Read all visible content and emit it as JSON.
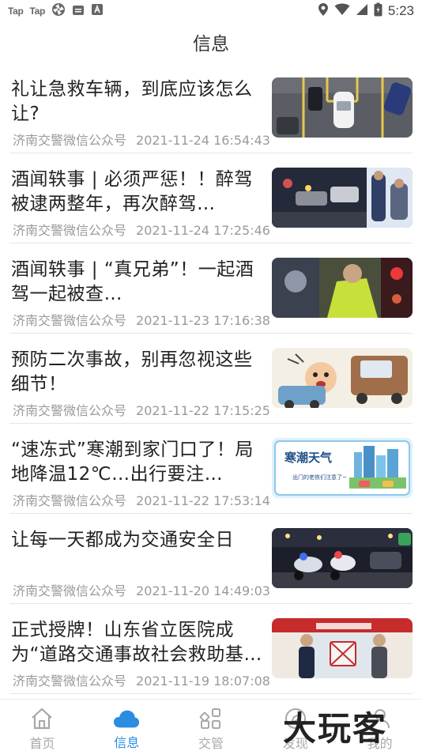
{
  "status_bar": {
    "apps": [
      "Tap",
      "Tap"
    ],
    "time": "5:23"
  },
  "header": {
    "title": "信息"
  },
  "news": [
    {
      "title": "礼让急救车辆，到底应该怎么让?",
      "source": "济南交警微信公众号",
      "datetime": "2021-11-24 16:54:43",
      "image": "parking-lot-cars"
    },
    {
      "title": "酒闻轶事 | 必须严惩！！醉驾被逮两整年，再次醉驾…",
      "source": "济南交警微信公众号",
      "datetime": "2021-11-24 17:25:46",
      "image": "night-checkpoint"
    },
    {
      "title": "酒闻轶事 | “真兄弟”！一起酒驾一起被查…",
      "source": "济南交警微信公众号",
      "datetime": "2021-11-23 17:16:38",
      "image": "police-inspection"
    },
    {
      "title": "预防二次事故，别再忽视这些细节！",
      "source": "济南交警微信公众号",
      "datetime": "2021-11-22 17:15:25",
      "image": "cartoon-accident"
    },
    {
      "title": "“速冻式”寒潮到家门口了！局地降温12℃…出行要注…",
      "source": "济南交警微信公众号",
      "datetime": "2021-11-22 17:53:14",
      "image": "cold-wave"
    },
    {
      "title": "让每一天都成为交通安全日",
      "source": "济南交警微信公众号",
      "datetime": "2021-11-20 14:49:03",
      "image": "police-motorcycles"
    },
    {
      "title": "正式授牌！山东省立医院成为“道路交通事故社会救助基…",
      "source": "济南交警微信公众号",
      "datetime": "2021-11-19 18:07:08",
      "image": "award-ceremony"
    }
  ],
  "thumb_text": {
    "cold_wave_title": "寒潮天气",
    "cold_wave_sub": "出门的老铁们注意了~"
  },
  "tabs": [
    {
      "label": "首页",
      "icon": "home-icon",
      "active": false
    },
    {
      "label": "信息",
      "icon": "cloud-icon",
      "active": true
    },
    {
      "label": "交管",
      "icon": "grid-icon",
      "active": false
    },
    {
      "label": "发现",
      "icon": "discover-icon",
      "active": false
    },
    {
      "label": "我的",
      "icon": "profile-icon",
      "active": false
    }
  ],
  "watermark": "大玩客",
  "colors": {
    "accent": "#2b8de0",
    "inactive": "#a8a8a8"
  }
}
